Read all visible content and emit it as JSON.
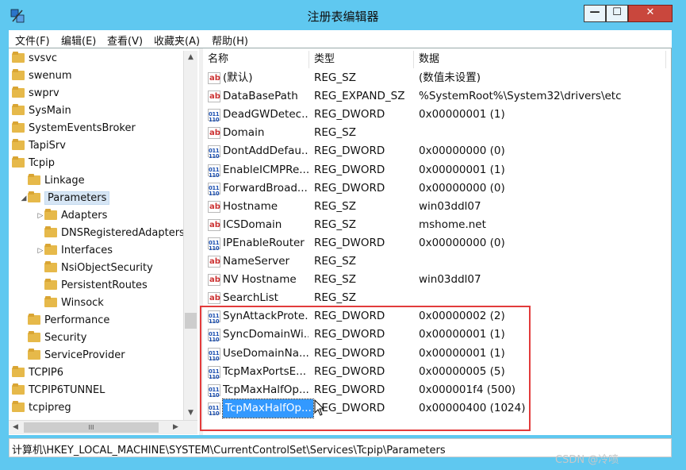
{
  "window": {
    "title": "注册表编辑器",
    "controls": {
      "minimize": "—",
      "maximize": "☐",
      "close": "✕"
    }
  },
  "menu": [
    "文件(F)",
    "编辑(E)",
    "查看(V)",
    "收藏夹(A)",
    "帮助(H)"
  ],
  "tree": {
    "items": [
      {
        "label": "svsvc",
        "level": 0
      },
      {
        "label": "swenum",
        "level": 0
      },
      {
        "label": "swprv",
        "level": 0
      },
      {
        "label": "SysMain",
        "level": 0
      },
      {
        "label": "SystemEventsBroker",
        "level": 0
      },
      {
        "label": "TapiSrv",
        "level": 0
      },
      {
        "label": "Tcpip",
        "level": 0,
        "expanded": true
      },
      {
        "label": "Linkage",
        "level": 1
      },
      {
        "label": "Parameters",
        "level": 1,
        "expanded": true,
        "selected": true
      },
      {
        "label": "Adapters",
        "level": 2,
        "collapsed": true
      },
      {
        "label": "DNSRegisteredAdapters",
        "level": 2
      },
      {
        "label": "Interfaces",
        "level": 2,
        "collapsed": true
      },
      {
        "label": "NsiObjectSecurity",
        "level": 2
      },
      {
        "label": "PersistentRoutes",
        "level": 2
      },
      {
        "label": "Winsock",
        "level": 2
      },
      {
        "label": "Performance",
        "level": 1
      },
      {
        "label": "Security",
        "level": 1
      },
      {
        "label": "ServiceProvider",
        "level": 1
      },
      {
        "label": "TCPIP6",
        "level": 0
      },
      {
        "label": "TCPIP6TUNNEL",
        "level": 0
      },
      {
        "label": "tcpipreg",
        "level": 0
      }
    ],
    "hscroll_label": "III"
  },
  "list": {
    "columns": [
      "名称",
      "类型",
      "数据"
    ],
    "rows": [
      {
        "icon": "sz",
        "name": "(默认)",
        "type": "REG_SZ",
        "data": "(数值未设置)"
      },
      {
        "icon": "sz",
        "name": "DataBasePath",
        "type": "REG_EXPAND_SZ",
        "data": "%SystemRoot%\\System32\\drivers\\etc"
      },
      {
        "icon": "dw",
        "name": "DeadGWDetec...",
        "type": "REG_DWORD",
        "data": "0x00000001 (1)"
      },
      {
        "icon": "sz",
        "name": "Domain",
        "type": "REG_SZ",
        "data": ""
      },
      {
        "icon": "dw",
        "name": "DontAddDefau...",
        "type": "REG_DWORD",
        "data": "0x00000000 (0)"
      },
      {
        "icon": "dw",
        "name": "EnableICMPRe...",
        "type": "REG_DWORD",
        "data": "0x00000001 (1)"
      },
      {
        "icon": "dw",
        "name": "ForwardBroad...",
        "type": "REG_DWORD",
        "data": "0x00000000 (0)"
      },
      {
        "icon": "sz",
        "name": "Hostname",
        "type": "REG_SZ",
        "data": "win03ddl07"
      },
      {
        "icon": "sz",
        "name": "ICSDomain",
        "type": "REG_SZ",
        "data": "mshome.net"
      },
      {
        "icon": "dw",
        "name": "IPEnableRouter",
        "type": "REG_DWORD",
        "data": "0x00000000 (0)"
      },
      {
        "icon": "sz",
        "name": "NameServer",
        "type": "REG_SZ",
        "data": ""
      },
      {
        "icon": "sz",
        "name": "NV Hostname",
        "type": "REG_SZ",
        "data": "win03ddl07"
      },
      {
        "icon": "sz",
        "name": "SearchList",
        "type": "REG_SZ",
        "data": ""
      },
      {
        "icon": "dw",
        "name": "SynAttackProte...",
        "type": "REG_DWORD",
        "data": "0x00000002 (2)"
      },
      {
        "icon": "dw",
        "name": "SyncDomainWi...",
        "type": "REG_DWORD",
        "data": "0x00000001 (1)"
      },
      {
        "icon": "dw",
        "name": "UseDomainNa...",
        "type": "REG_DWORD",
        "data": "0x00000001 (1)"
      },
      {
        "icon": "dw",
        "name": "TcpMaxPortsE...",
        "type": "REG_DWORD",
        "data": "0x00000005 (5)"
      },
      {
        "icon": "dw",
        "name": "TcpMaxHalfOp...",
        "type": "REG_DWORD",
        "data": "0x000001f4 (500)"
      },
      {
        "icon": "dw",
        "name": "TcpMaxHalfOp...",
        "type": "REG_DWORD",
        "data": "0x00000400 (1024)",
        "selected": true
      }
    ]
  },
  "status": {
    "path": "计算机\\HKEY_LOCAL_MACHINE\\SYSTEM\\CurrentControlSet\\Services\\Tcpip\\Parameters"
  },
  "watermark": "CSDN @冷喷",
  "colors": {
    "highlight_box": "#e23b3b",
    "selection": "#3399ff",
    "window_frame": "#5fc8f0"
  }
}
